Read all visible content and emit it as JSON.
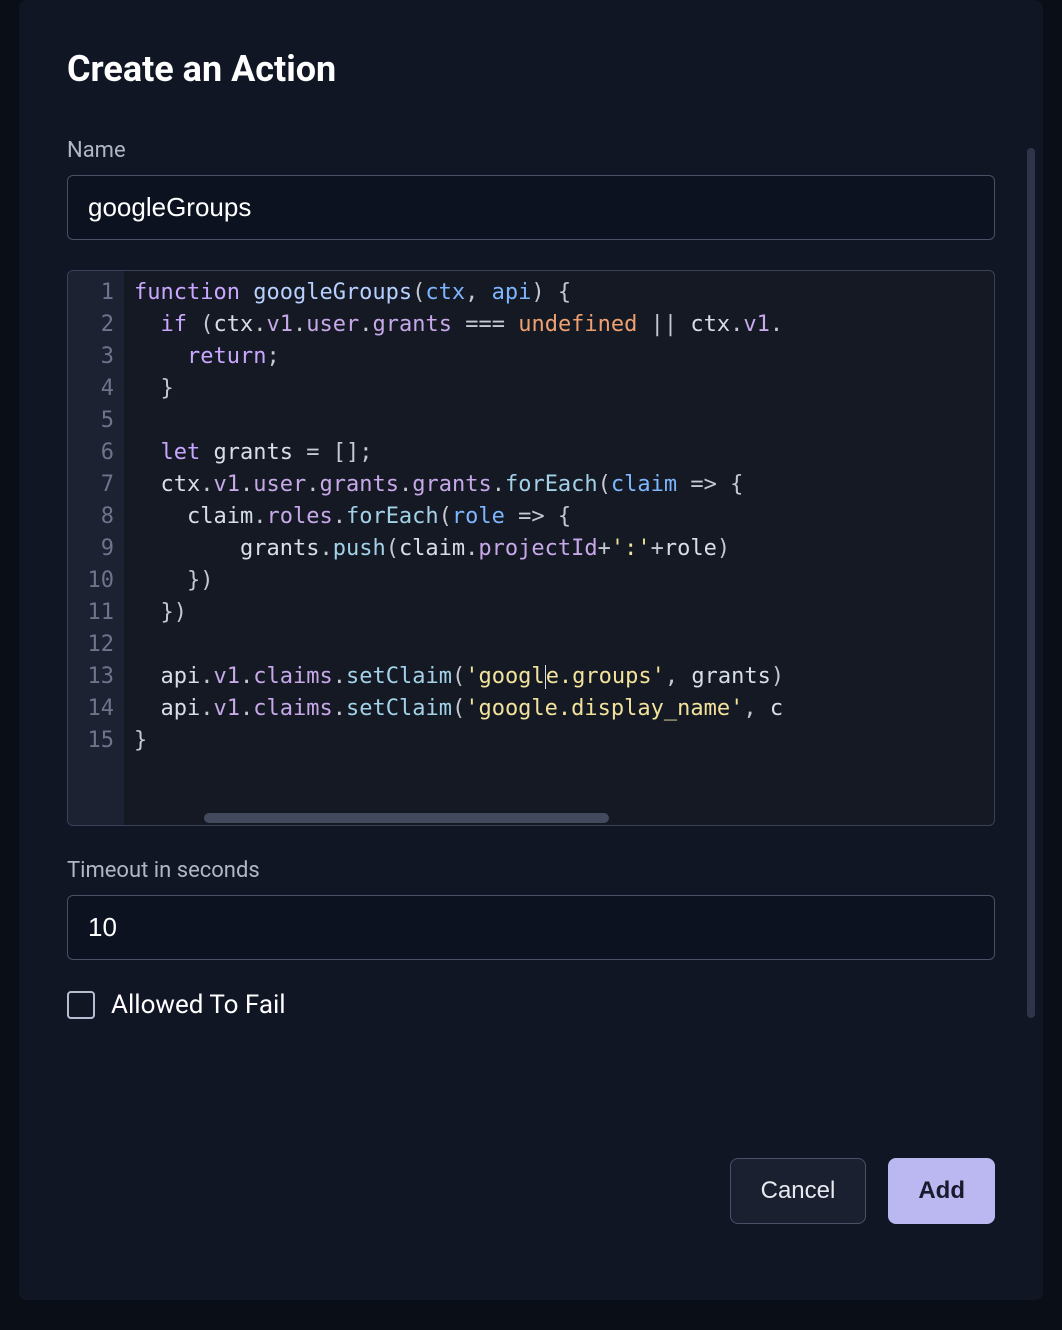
{
  "modal": {
    "title": "Create an Action",
    "name_label": "Name",
    "name_value": "googleGroups",
    "timeout_label": "Timeout in seconds",
    "timeout_value": "10",
    "allowed_label": "Allowed To Fail",
    "allowed_checked": false,
    "cancel_label": "Cancel",
    "add_label": "Add"
  },
  "editor": {
    "line_count": 15,
    "lines": [
      [
        {
          "t": "kw",
          "v": "function"
        },
        {
          "t": "sp"
        },
        {
          "t": "fn",
          "v": "googleGroups"
        },
        {
          "t": "punc",
          "v": "("
        },
        {
          "t": "param",
          "v": "ctx"
        },
        {
          "t": "punc",
          "v": ", "
        },
        {
          "t": "param",
          "v": "api"
        },
        {
          "t": "punc",
          "v": ") {"
        }
      ],
      [
        {
          "t": "indent",
          "n": 2
        },
        {
          "t": "kw",
          "v": "if"
        },
        {
          "t": "punc",
          "v": " ("
        },
        {
          "t": "ident",
          "v": "ctx"
        },
        {
          "t": "punc",
          "v": "."
        },
        {
          "t": "prop",
          "v": "v1"
        },
        {
          "t": "punc",
          "v": "."
        },
        {
          "t": "prop",
          "v": "user"
        },
        {
          "t": "punc",
          "v": "."
        },
        {
          "t": "prop",
          "v": "grants"
        },
        {
          "t": "punc",
          "v": " === "
        },
        {
          "t": "const",
          "v": "undefined"
        },
        {
          "t": "punc",
          "v": " || "
        },
        {
          "t": "ident",
          "v": "ctx"
        },
        {
          "t": "punc",
          "v": "."
        },
        {
          "t": "prop",
          "v": "v1"
        },
        {
          "t": "punc",
          "v": "."
        }
      ],
      [
        {
          "t": "indent",
          "n": 4
        },
        {
          "t": "kw",
          "v": "return"
        },
        {
          "t": "punc",
          "v": ";"
        }
      ],
      [
        {
          "t": "indent",
          "n": 2
        },
        {
          "t": "punc",
          "v": "}"
        }
      ],
      [],
      [
        {
          "t": "indent",
          "n": 2
        },
        {
          "t": "kw",
          "v": "let"
        },
        {
          "t": "sp"
        },
        {
          "t": "local",
          "v": "grants"
        },
        {
          "t": "punc",
          "v": " = [];"
        }
      ],
      [
        {
          "t": "indent",
          "n": 2
        },
        {
          "t": "ident",
          "v": "ctx"
        },
        {
          "t": "punc",
          "v": "."
        },
        {
          "t": "prop",
          "v": "v1"
        },
        {
          "t": "punc",
          "v": "."
        },
        {
          "t": "prop",
          "v": "user"
        },
        {
          "t": "punc",
          "v": "."
        },
        {
          "t": "prop",
          "v": "grants"
        },
        {
          "t": "punc",
          "v": "."
        },
        {
          "t": "prop",
          "v": "grants"
        },
        {
          "t": "punc",
          "v": "."
        },
        {
          "t": "call",
          "v": "forEach"
        },
        {
          "t": "punc",
          "v": "("
        },
        {
          "t": "param",
          "v": "claim"
        },
        {
          "t": "punc",
          "v": " => {"
        }
      ],
      [
        {
          "t": "indent",
          "n": 4
        },
        {
          "t": "ident",
          "v": "claim"
        },
        {
          "t": "punc",
          "v": "."
        },
        {
          "t": "prop",
          "v": "roles"
        },
        {
          "t": "punc",
          "v": "."
        },
        {
          "t": "call",
          "v": "forEach"
        },
        {
          "t": "punc",
          "v": "("
        },
        {
          "t": "param",
          "v": "role"
        },
        {
          "t": "punc",
          "v": " => {"
        }
      ],
      [
        {
          "t": "indent",
          "n": 8
        },
        {
          "t": "ident",
          "v": "grants"
        },
        {
          "t": "punc",
          "v": "."
        },
        {
          "t": "call",
          "v": "push"
        },
        {
          "t": "punc",
          "v": "("
        },
        {
          "t": "ident",
          "v": "claim"
        },
        {
          "t": "punc",
          "v": "."
        },
        {
          "t": "prop",
          "v": "projectId"
        },
        {
          "t": "punc",
          "v": "+"
        },
        {
          "t": "str",
          "v": "':'"
        },
        {
          "t": "punc",
          "v": "+"
        },
        {
          "t": "ident",
          "v": "role"
        },
        {
          "t": "punc",
          "v": ")"
        }
      ],
      [
        {
          "t": "indent",
          "n": 4
        },
        {
          "t": "punc",
          "v": "})"
        }
      ],
      [
        {
          "t": "indent",
          "n": 2
        },
        {
          "t": "punc",
          "v": "})"
        }
      ],
      [],
      [
        {
          "t": "indent",
          "n": 2
        },
        {
          "t": "ident",
          "v": "api"
        },
        {
          "t": "punc",
          "v": "."
        },
        {
          "t": "prop",
          "v": "v1"
        },
        {
          "t": "punc",
          "v": "."
        },
        {
          "t": "prop",
          "v": "claims"
        },
        {
          "t": "punc",
          "v": "."
        },
        {
          "t": "call",
          "v": "setClaim"
        },
        {
          "t": "punc",
          "v": "("
        },
        {
          "t": "str",
          "v": "'googl"
        },
        {
          "t": "caret"
        },
        {
          "t": "str",
          "v": "e.groups'"
        },
        {
          "t": "punc",
          "v": ", "
        },
        {
          "t": "ident",
          "v": "grants"
        },
        {
          "t": "punc",
          "v": ")"
        }
      ],
      [
        {
          "t": "indent",
          "n": 2
        },
        {
          "t": "ident",
          "v": "api"
        },
        {
          "t": "punc",
          "v": "."
        },
        {
          "t": "prop",
          "v": "v1"
        },
        {
          "t": "punc",
          "v": "."
        },
        {
          "t": "prop",
          "v": "claims"
        },
        {
          "t": "punc",
          "v": "."
        },
        {
          "t": "call",
          "v": "setClaim"
        },
        {
          "t": "punc",
          "v": "("
        },
        {
          "t": "str",
          "v": "'google.display_name'"
        },
        {
          "t": "punc",
          "v": ", "
        },
        {
          "t": "ident",
          "v": "c"
        }
      ],
      [
        {
          "t": "punc",
          "v": "}"
        }
      ]
    ]
  }
}
